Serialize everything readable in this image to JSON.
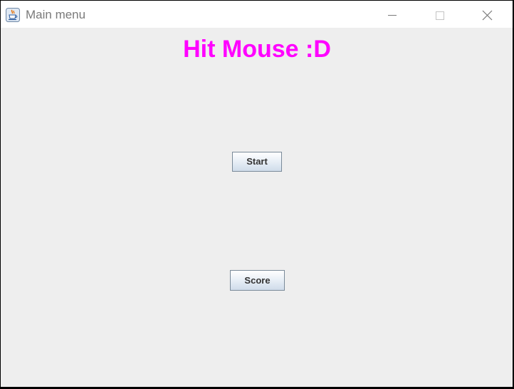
{
  "window": {
    "title": "Main menu",
    "icon": "java-cup-icon",
    "controls": {
      "minimize": "minimize-icon",
      "maximize": "maximize-icon",
      "close": "close-icon"
    }
  },
  "main": {
    "heading": "Hit Mouse :D",
    "heading_color": "#ff00ff",
    "start_label": "Start",
    "score_label": "Score"
  }
}
